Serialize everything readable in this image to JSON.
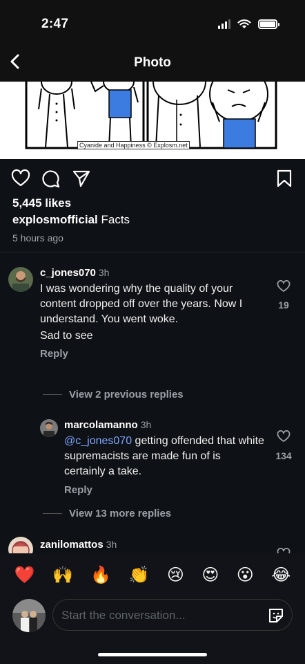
{
  "status": {
    "time": "2:47"
  },
  "nav": {
    "title": "Photo"
  },
  "photo": {
    "credit": "Cyanide and Happiness © Explosm.net"
  },
  "post": {
    "likes": "5,445 likes",
    "username": "explosmofficial",
    "caption": "Facts",
    "time_ago": "5 hours ago"
  },
  "comments": [
    {
      "user": "c_jones070",
      "time": "3h",
      "text": "I was wondering why the quality of your content dropped off over the years. Now I understand. You went woke.",
      "text2": "Sad to see",
      "reply": "Reply",
      "likes": "19"
    }
  ],
  "view_previous": "View 2 previous replies",
  "reply_comment": {
    "user": "marcolamanno",
    "time": "3h",
    "mention": "@c_jones070",
    "text": "getting offended that white supremacists are made fun of is certainly a take.",
    "reply": "Reply",
    "likes": "134"
  },
  "view_more": "View 13 more replies",
  "next_comment": {
    "user": "zanilomattos",
    "time": "3h"
  },
  "emojis": [
    "❤️",
    "🙌",
    "🔥",
    "👏",
    "😢",
    "😍",
    "😮",
    "😂"
  ],
  "composer": {
    "placeholder": "Start the conversation..."
  }
}
